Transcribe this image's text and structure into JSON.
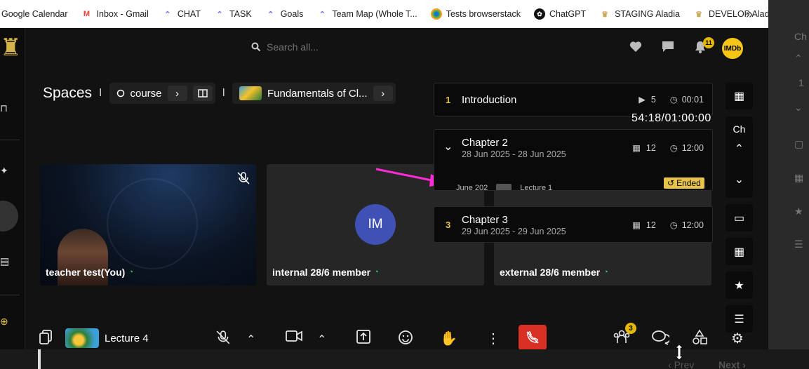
{
  "bookmarks": [
    {
      "label": "Google Calendar",
      "icon": "calendar-icon",
      "color": "#4285f4"
    },
    {
      "label": "Inbox - Gmail",
      "icon": "gmail-icon",
      "color": "#ea4335"
    },
    {
      "label": "CHAT",
      "icon": "clickup-icon",
      "color": "#7b68ee"
    },
    {
      "label": "TASK",
      "icon": "clickup-icon",
      "color": "#7b68ee"
    },
    {
      "label": "Goals",
      "icon": "clickup-icon",
      "color": "#7b68ee"
    },
    {
      "label": "Team Map (Whole T...",
      "icon": "clickup-icon",
      "color": "#7b68ee"
    },
    {
      "label": "Tests browserstack",
      "icon": "browserstack-icon",
      "color": "#f89b1e"
    },
    {
      "label": "ChatGPT",
      "icon": "chatgpt-icon",
      "color": "#000000"
    },
    {
      "label": "STAGING Aladia",
      "icon": "aladia-icon",
      "color": "#caa85a"
    },
    {
      "label": "DEVELOP Aladia",
      "icon": "aladia-icon",
      "color": "#caa85a"
    }
  ],
  "search": {
    "placeholder": "Search all..."
  },
  "notifications": {
    "count": "11"
  },
  "profile": {
    "label": "IMDb"
  },
  "breadcrumb": {
    "title": "Spaces",
    "course_label": "course",
    "course_title": "Fundamentals of Cl..."
  },
  "participants": [
    {
      "name": "teacher test(You)"
    },
    {
      "name": "internal 28/6 member",
      "initials": "IM"
    },
    {
      "name": "external 28/6 member"
    }
  ],
  "chapters": [
    {
      "num": "1",
      "title": "Introduction",
      "videos": "5",
      "duration": "00:01"
    },
    {
      "title": "Chapter 2",
      "dates": "28 Jun 2025 - 28 Jun 2025",
      "lessons": "12",
      "duration": "12:00",
      "lesson_preview": "June 202",
      "lesson_label": "Lecture 1",
      "status": "Ended"
    },
    {
      "num": "3",
      "title": "Chapter 3",
      "dates": "29 Jun 2025 - 29 Jun 2025",
      "lessons": "12",
      "duration": "12:00"
    }
  ],
  "timer": "54:18/01:00:00",
  "side_panel": {
    "label": "Ch"
  },
  "bottom": {
    "lecture": "Lecture 4",
    "people_count": "3"
  },
  "pager": {
    "prev": "Prev",
    "next": "Next"
  },
  "colors": {
    "accent": "#e8c34a",
    "hangup": "#d93025",
    "avatar": "#3f51b5",
    "arrow": "#ff2bd6",
    "online": "#2bd46b"
  }
}
